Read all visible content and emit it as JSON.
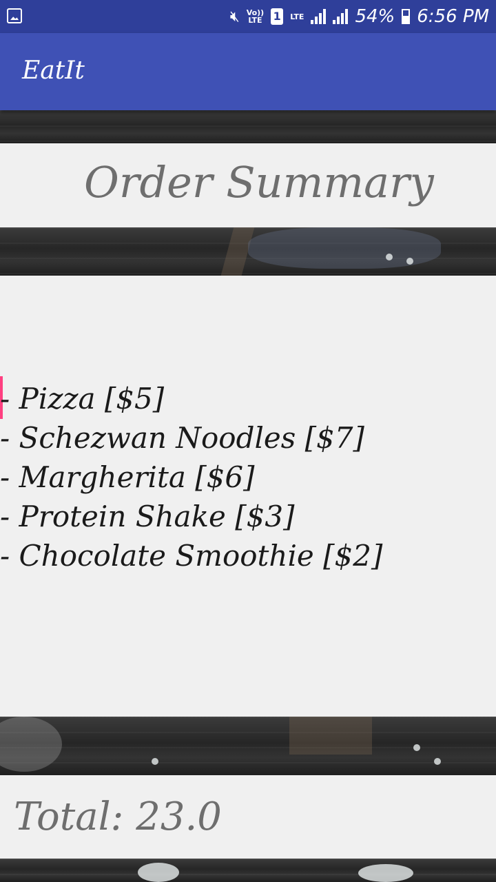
{
  "status_bar": {
    "network_top": "Vo))",
    "network_bottom": "LTE",
    "sim": "1",
    "lte": "LTE",
    "battery": "54%",
    "time": "6:56 PM"
  },
  "app_bar": {
    "title": "EatIt"
  },
  "summary": {
    "title": "Order Summary",
    "items": [
      "- Pizza [$5]",
      "- Schezwan Noodles [$7]",
      "- Margherita [$6]",
      "- Protein Shake [$3]",
      "- Chocolate Smoothie [$2]"
    ]
  },
  "total": {
    "text": "Total: 23.0"
  },
  "colors": {
    "status_bar": "#2f3f9a",
    "app_bar": "#3f51b5",
    "panel": "#f0f0f0",
    "cursor": "#ff4081"
  }
}
